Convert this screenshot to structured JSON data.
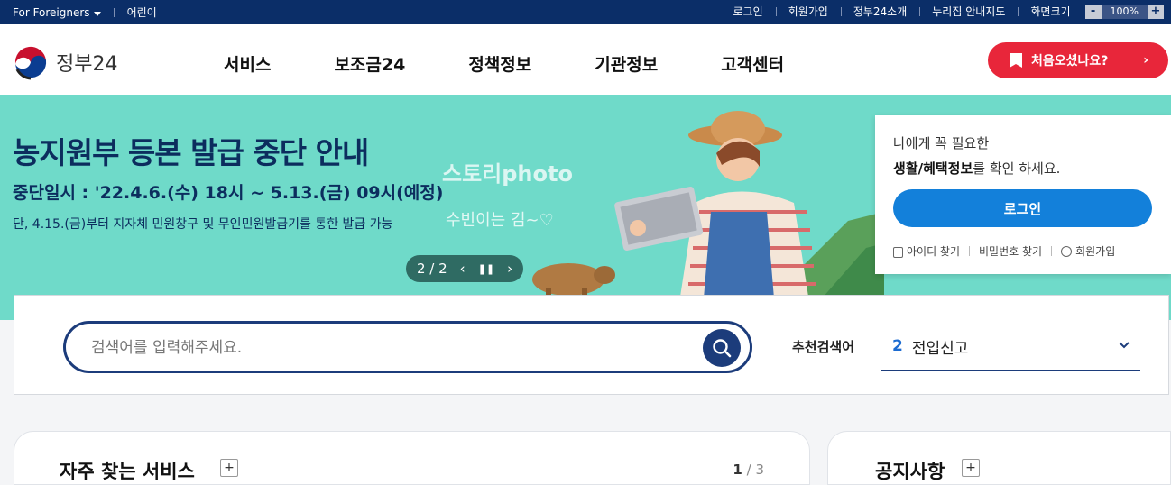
{
  "topbar": {
    "foreigners": "For Foreigners",
    "kids": "어린이",
    "links": [
      "로그인",
      "회원가입",
      "정부24소개",
      "누리집 안내지도"
    ],
    "zoom_label": "화면크기",
    "zoom_minus": "-",
    "zoom_value": "100%",
    "zoom_plus": "+"
  },
  "header": {
    "logo_text": "정부24",
    "menu": [
      "서비스",
      "보조금24",
      "정책정보",
      "기관정보",
      "고객센터"
    ],
    "first_visit": "처음오셨나요?",
    "first_visit_arrow": "›"
  },
  "banner": {
    "title": "농지원부 등본 발급 중단 안내",
    "subtitle": "중단일시 : '22.4.6.(수) 18시 ~ 5.13.(금) 09시(예정)",
    "description": "단, 4.15.(금)부터 지자체 민원창구 및 무인민원발급기를 통한 발급 가능",
    "pager_text": "2 / 2",
    "watermark_1": "스토리photo",
    "watermark_2": "수빈이는 김~♡"
  },
  "login_card": {
    "line1": "나에게 꼭 필요한",
    "line2_bold": "생활/혜택정보",
    "line2_rest": "를 확인 하세요.",
    "login_button": "로그인",
    "find_id": "아이디 찾기",
    "find_pw": "비밀번호 찾기",
    "signup": "회원가입"
  },
  "search": {
    "placeholder": "검색어를 입력해주세요.",
    "recommend_label": "추천검색어",
    "recommend_num": "2",
    "recommend_value": "전입신고"
  },
  "cards": {
    "frequent_title": "자주 찾는 서비스",
    "page_current": "1",
    "page_total": "/ 3",
    "notice_title": "공지사항",
    "plus": "+"
  },
  "colors": {
    "topbar": "#0b2e68",
    "banner": "#6fdac9",
    "accent_red": "#e8263a",
    "login_blue": "#1380da",
    "search_border": "#1c3c7b"
  }
}
